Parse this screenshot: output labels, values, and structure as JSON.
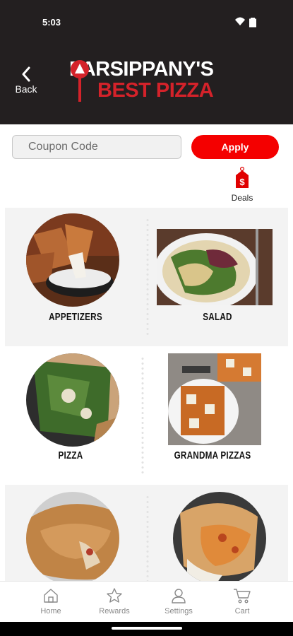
{
  "status_bar": {
    "time": "5:03"
  },
  "header": {
    "back_label": "Back",
    "logo_line1": "PARSIPPANY'S",
    "logo_line2": "BEST PIZZA"
  },
  "coupon": {
    "placeholder": "Coupon Code",
    "apply_label": "Apply"
  },
  "deals": {
    "label": "Deals"
  },
  "categories": [
    {
      "label": "APPETIZERS"
    },
    {
      "label": "SALAD"
    },
    {
      "label": "PIZZA"
    },
    {
      "label": "GRANDMA PIZZAS"
    },
    {
      "label": ""
    },
    {
      "label": ""
    }
  ],
  "bottom_nav": [
    {
      "label": "Home",
      "icon": "home-icon"
    },
    {
      "label": "Rewards",
      "icon": "star-icon"
    },
    {
      "label": "Settings",
      "icon": "user-icon"
    },
    {
      "label": "Cart",
      "icon": "cart-icon"
    }
  ],
  "colors": {
    "header_bg": "#231f20",
    "accent_red": "#f40000",
    "logo_red": "#d4222a"
  }
}
